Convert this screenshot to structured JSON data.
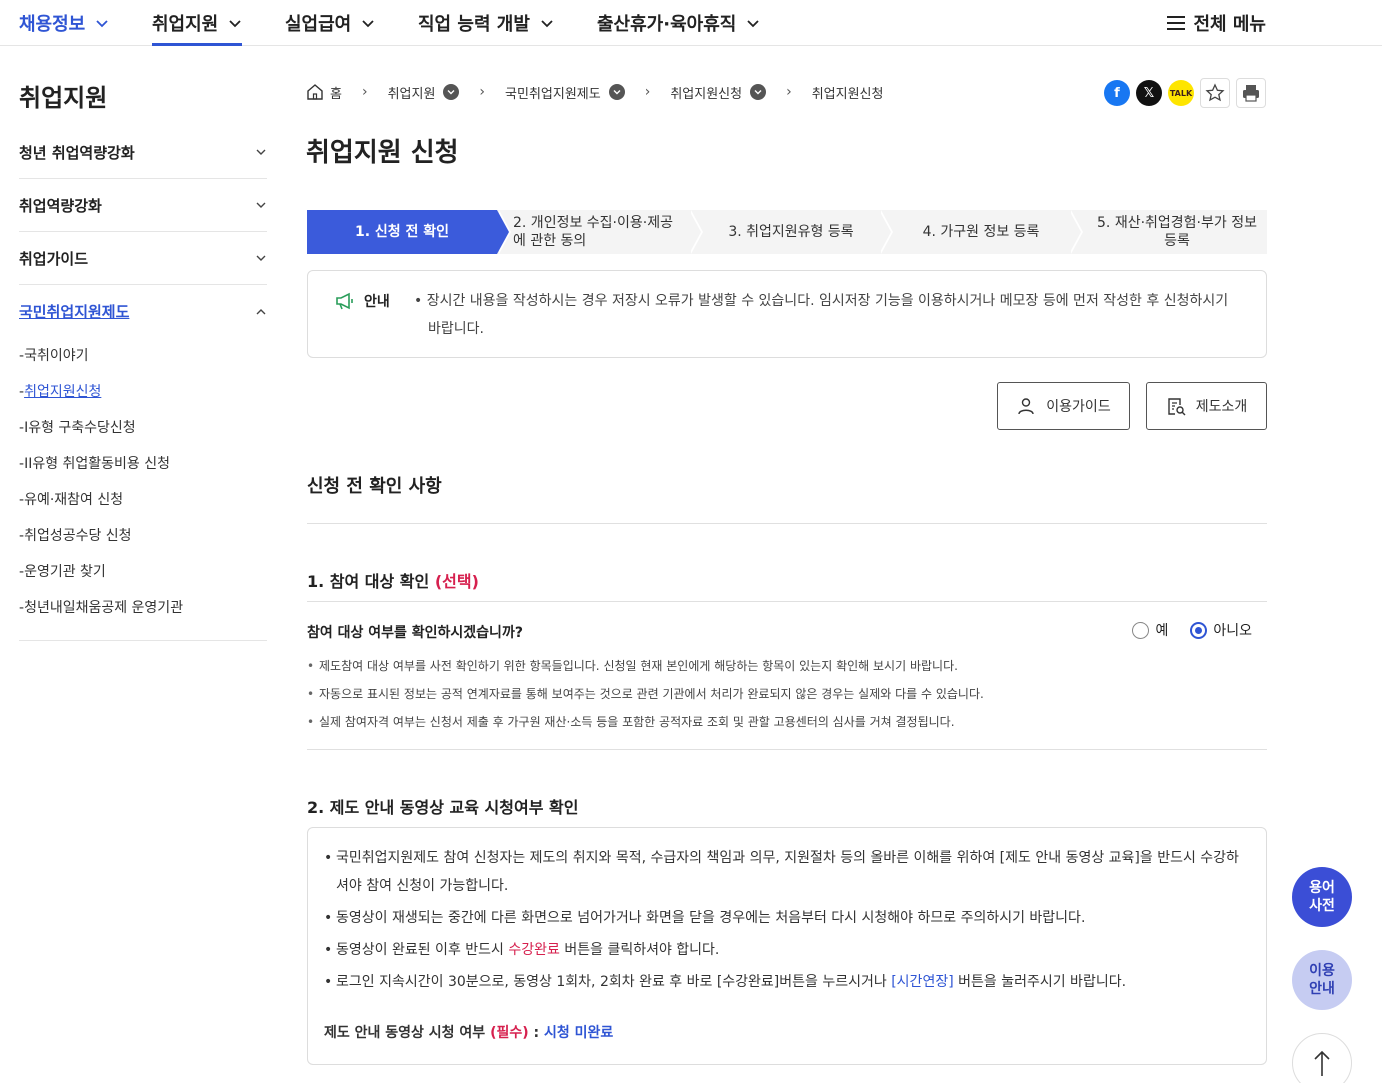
{
  "topnav": {
    "items": [
      {
        "label": "채용정보"
      },
      {
        "label": "취업지원"
      },
      {
        "label": "실업급여"
      },
      {
        "label": "직업 능력 개발"
      },
      {
        "label": "출산휴가·육아휴직"
      }
    ],
    "all_menu": "전체 메뉴"
  },
  "sidebar": {
    "title": "취업지원",
    "items": [
      {
        "label": "청년 취업역량강화"
      },
      {
        "label": "취업역량강화"
      },
      {
        "label": "취업가이드"
      },
      {
        "label": "국민취업지원제도"
      }
    ],
    "sub_items": [
      {
        "label": "국취이야기"
      },
      {
        "label": "취업지원신청"
      },
      {
        "label": "I유형 구축수당신청"
      },
      {
        "label": "II유형 취업활동비용 신청"
      },
      {
        "label": "유예·재참여 신청"
      },
      {
        "label": "취업성공수당 신청"
      },
      {
        "label": "운영기관 찾기"
      },
      {
        "label": "청년내일채움공제 운영기관"
      }
    ]
  },
  "breadcrumb": {
    "home": "홈",
    "items": [
      "취업지원",
      "국민취업지원제도",
      "취업지원신청",
      "취업지원신청"
    ]
  },
  "share": {
    "kakao": "TALK"
  },
  "page_title": "취업지원 신청",
  "steps": [
    {
      "label": "1. 신청 전 확인"
    },
    {
      "label": "2. 개인정보 수집·이용·제공에 관한 동의"
    },
    {
      "label": "3. 취업지원유형 등록"
    },
    {
      "label": "4. 가구원 정보 등록"
    },
    {
      "label": "5. 재산·취업경험·부가 정보 등록"
    }
  ],
  "notice": {
    "label": "안내",
    "text": "• 장시간 내용을 작성하시는 경우 저장시 오류가 발생할 수 있습니다. 임시저장 기능을 이용하시거나 메모장 등에 먼저 작성한 후 신청하시기 바랍니다."
  },
  "buttons": {
    "guide": "이용가이드",
    "intro": "제도소개"
  },
  "section_title": "신청 전 확인 사항",
  "section1": {
    "title": "1. 참여 대상 확인",
    "tag": "(선택)",
    "question": "참여 대상 여부를 확인하시겠습니까?",
    "options": [
      "예",
      "아니오"
    ],
    "selected": "아니오",
    "bullets": [
      "제도참여 대상 여부를 사전 확인하기 위한 항목들입니다. 신청일 현재 본인에게 해당하는 항목이 있는지 확인해 보시기 바랍니다.",
      "자동으로 표시된 정보는 공적 연계자료를 통해 보여주는 것으로 관련 기관에서 처리가 완료되지 않은 경우는 실제와 다를 수 있습니다.",
      "실제 참여자격 여부는 신청서 제출 후 가구원 재산·소득 등을 포함한 공적자료 조회 및 관할 고용센터의 심사를 거쳐 결정됩니다."
    ]
  },
  "section2": {
    "title": "2. 제도 안내 동영상 교육 시청여부 확인",
    "b1": "국민취업지원제도 참여 신청자는 제도의 취지와 목적, 수급자의 책임과 의무, 지원절차 등의 올바른 이해를 위하여 [제도 안내 동영상 교육]을 반드시 수강하셔야 참여 신청이 가능합니다.",
    "b2": "동영상이 재생되는 중간에 다른 화면으로 넘어가거나 화면을 닫을 경우에는 처음부터 다시 시청해야 하므로 주의하시기 바랍니다.",
    "b3_pre": "동영상이 완료된 이후 반드시 ",
    "b3_red": "수강완료",
    "b3_post": " 버튼을 클릭하셔야 합니다.",
    "b4_pre": "로그인 지속시간이 30분으로, 동영상 1회차, 2회차 완료 후 바로 [수강완료]버튼을 누르시거나 ",
    "b4_blue": "[시간연장]",
    "b4_post": " 버튼을 눌러주시기 바랍니다.",
    "status_label": "제도 안내 동영상 시청 여부",
    "status_tag": "(필수)",
    "status_colon": " : ",
    "status_value": "시청 미완료"
  },
  "fabs": {
    "dict": [
      "용어",
      "사전"
    ],
    "guide": [
      "이용",
      "안내"
    ]
  },
  "colors": {
    "primary": "#3b5bdb",
    "link": "#2f55d4",
    "required": "#d6204e"
  }
}
